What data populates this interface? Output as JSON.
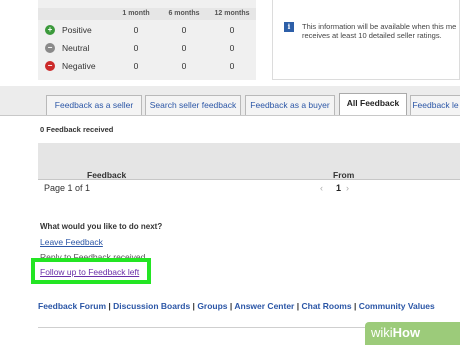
{
  "ratings": {
    "columns": [
      "1 month",
      "6 months",
      "12 months"
    ],
    "rows": [
      {
        "label": "Positive",
        "icon": "plus-icon",
        "color": "#3c9a3c",
        "values": [
          "0",
          "0",
          "0"
        ]
      },
      {
        "label": "Neutral",
        "icon": "minus-gray-icon",
        "color": "#8a8a8a",
        "values": [
          "0",
          "0",
          "0"
        ]
      },
      {
        "label": "Negative",
        "icon": "minus-red-icon",
        "color": "#cc2a2a",
        "values": [
          "0",
          "0",
          "0"
        ]
      }
    ]
  },
  "info": {
    "icon": "info-icon",
    "line1": "This information will be available when this me",
    "line2": "receives at least 10 detailed seller ratings."
  },
  "tabs": [
    {
      "label": "Feedback as a seller",
      "active": false
    },
    {
      "label": "Search seller feedback",
      "active": false
    },
    {
      "label": "Feedback as a buyer",
      "active": false
    },
    {
      "label": "All Feedback",
      "active": true
    },
    {
      "label": "Feedback le",
      "active": false
    }
  ],
  "received": "0 Feedback received",
  "table": {
    "col_feedback": "Feedback",
    "col_from": "From",
    "page_text": "Page 1 of 1",
    "prev_icon": "chevron-left-icon",
    "page_number": "1",
    "next_icon": "chevron-right-icon"
  },
  "next_steps": {
    "heading": "What would you like to do next?",
    "leave_feedback": "Leave Feedback",
    "reply_text": "Reply to Feedback received",
    "follow_up": "Follow up to Feedback left"
  },
  "footer": {
    "links": [
      "Feedback Forum",
      "Discussion Boards",
      "Groups",
      "Answer Center",
      "Chat Rooms",
      "Community Values"
    ],
    "separator": "|"
  },
  "watermark": {
    "part1": "wiki",
    "part2": "How"
  },
  "colors": {
    "link": "#2b56a6",
    "highlight": "#23e523",
    "visited": "#6a2ea8"
  }
}
